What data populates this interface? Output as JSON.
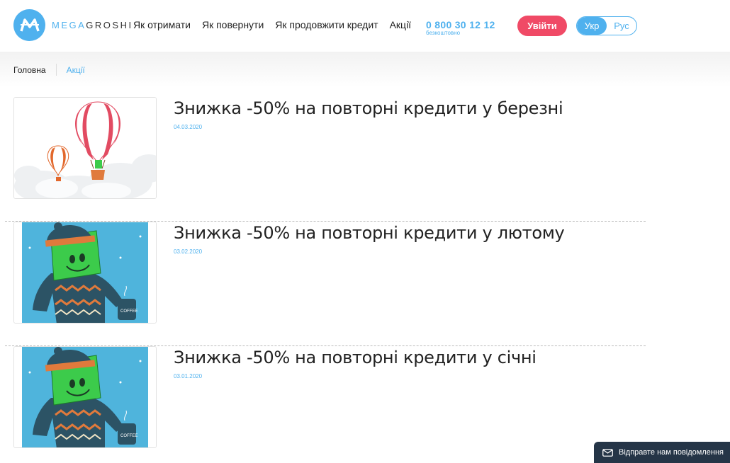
{
  "header": {
    "logo": {
      "prefix": "MEGA",
      "suffix": "GROSHI",
      "icon": "logo-m-icon"
    },
    "nav": [
      "Як отримати",
      "Як повернути",
      "Як продовжити кредит",
      "Акції"
    ],
    "phone": {
      "number": "0 800 30 12 12",
      "note": "безкоштовно"
    },
    "login_label": "Увійти",
    "languages": {
      "active": "Укр",
      "inactive": "Рус"
    }
  },
  "breadcrumb": {
    "home": "Головна",
    "current": "Акції"
  },
  "promos": [
    {
      "title": "Знижка -50% на повторні кредити у березні",
      "date": "04.03.2020",
      "image": "balloons-illustration"
    },
    {
      "title": "Знижка -50% на повторні кредити у лютому",
      "date": "03.02.2020",
      "image": "mascot-sweater-coffee"
    },
    {
      "title": "Знижка -50% на повторні кредити у січні",
      "date": "03.01.2020",
      "image": "mascot-sweater-coffee"
    }
  ],
  "chat": {
    "label": "Відправте нам повідомлення",
    "icon": "envelope-icon"
  },
  "colors": {
    "accent": "#4fb1ee",
    "login": "#f04a66",
    "chat_bg": "#253547"
  }
}
